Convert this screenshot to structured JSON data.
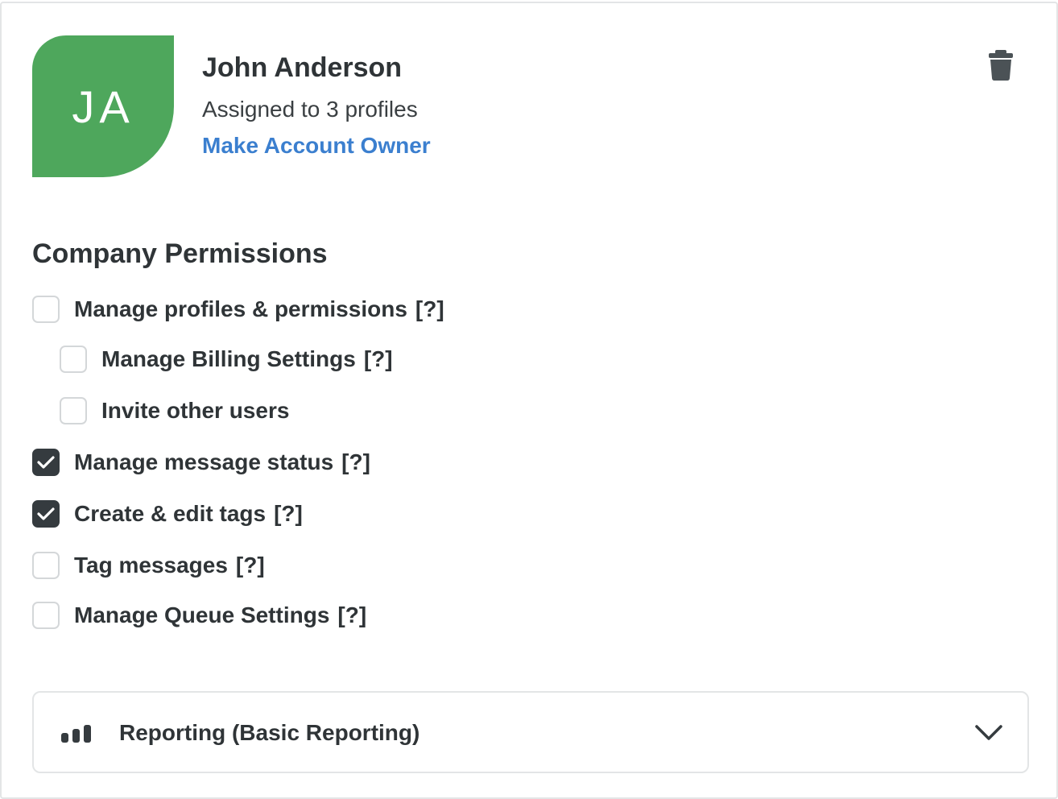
{
  "user": {
    "initials": "JA",
    "avatar_color": "#4ea75c",
    "name": "John Anderson",
    "assigned": "Assigned to 3 profiles",
    "make_owner": "Make Account Owner",
    "delete_icon": "trash-icon"
  },
  "permissions": {
    "title": "Company Permissions",
    "help_text": "[?]",
    "items": [
      {
        "label": "Manage profiles & permissions",
        "checked": false,
        "has_help": true,
        "indent": false
      },
      {
        "label": "Manage Billing Settings",
        "checked": false,
        "has_help": true,
        "indent": true
      },
      {
        "label": "Invite other users",
        "checked": false,
        "has_help": false,
        "indent": true
      },
      {
        "label": "Manage message status",
        "checked": true,
        "has_help": true,
        "indent": false
      },
      {
        "label": "Create & edit tags",
        "checked": true,
        "has_help": true,
        "indent": false
      },
      {
        "label": "Tag messages",
        "checked": false,
        "has_help": true,
        "indent": false
      },
      {
        "label": "Manage Queue Settings",
        "checked": false,
        "has_help": true,
        "indent": false
      }
    ]
  },
  "reporting": {
    "label": "Reporting (Basic Reporting)",
    "icon": "bar-chart-icon",
    "expand_icon": "chevron-down-icon"
  }
}
